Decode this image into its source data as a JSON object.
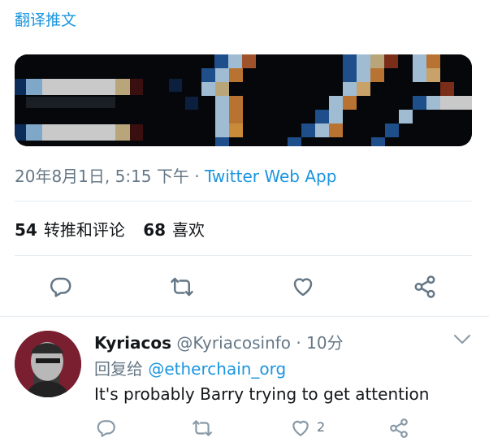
{
  "tweet": {
    "translate_label": "翻译推文",
    "meta": {
      "date": "20年8月1日, 5:15 下午",
      "separator": " · ",
      "source": "Twitter Web App"
    },
    "stats": {
      "retweets_count": "54",
      "retweets_label": "转推和评论",
      "likes_count": "68",
      "likes_label": "喜欢"
    },
    "actions": [
      "reply",
      "retweet",
      "like",
      "share"
    ]
  },
  "reply": {
    "name": "Kyriacos",
    "handle": "@Kyriacosinfo",
    "separator": " · ",
    "time": "10分",
    "reply_to_prefix": "回复给 ",
    "reply_to_handle": "@etherchain_org",
    "text": "It's probably Barry trying to get attention",
    "like_count": "2"
  },
  "colors": {
    "link": "#1b95e0",
    "muted": "#657786",
    "divider": "#e6ecf0"
  }
}
